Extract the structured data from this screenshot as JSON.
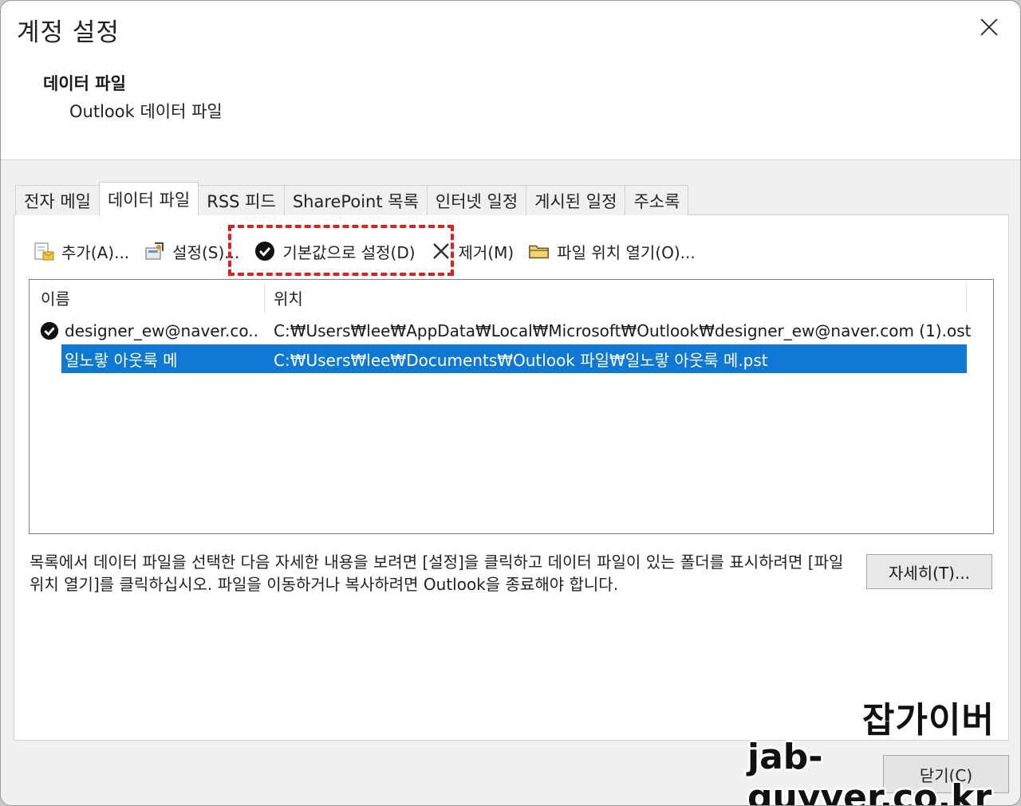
{
  "window": {
    "title": "계정 설정"
  },
  "header": {
    "section_title": "데이터 파일",
    "section_subtitle": "Outlook 데이터 파일"
  },
  "tabs": [
    {
      "label": "전자 메일"
    },
    {
      "label": "데이터 파일",
      "active": true
    },
    {
      "label": "RSS 피드"
    },
    {
      "label": "SharePoint 목록"
    },
    {
      "label": "인터넷 일정"
    },
    {
      "label": "게시된 일정"
    },
    {
      "label": "주소록"
    }
  ],
  "toolbar": {
    "add_label": "추가(A)...",
    "settings_label": "설정(S)...",
    "set_default_label": "기본값으로 설정(D)",
    "remove_label": "제거(M)",
    "open_location_label": "파일 위치 열기(O)..."
  },
  "list": {
    "columns": {
      "name": "이름",
      "location": "위치"
    },
    "rows": [
      {
        "name": "designer_ew@naver.co...",
        "location": "C:₩Users₩lee₩AppData₩Local₩Microsoft₩Outlook₩designer_ew@naver.com (1).ost",
        "default": true,
        "selected": false
      },
      {
        "name": "일노랗 아웃룩 메",
        "location": "C:₩Users₩lee₩Documents₩Outlook 파일₩일노랗 아웃룩 메.pst",
        "default": false,
        "selected": true
      }
    ]
  },
  "description": "목록에서 데이터 파일을 선택한 다음 자세한 내용을 보려면 [설정]을 클릭하고 데이터 파일이 있는 폴더를 표시하려면 [파일 위치 열기]를 클릭하십시오. 파일을 이동하거나 복사하려면 Outlook을 종료해야 합니다.",
  "buttons": {
    "details_label": "자세히(T)...",
    "close_label": "닫기(C)"
  },
  "watermark": {
    "line1": "잡가이버",
    "line2": "jab-guyver.co.kr"
  },
  "colors": {
    "selection": "#0f78d4",
    "highlight_box": "#e02020"
  }
}
